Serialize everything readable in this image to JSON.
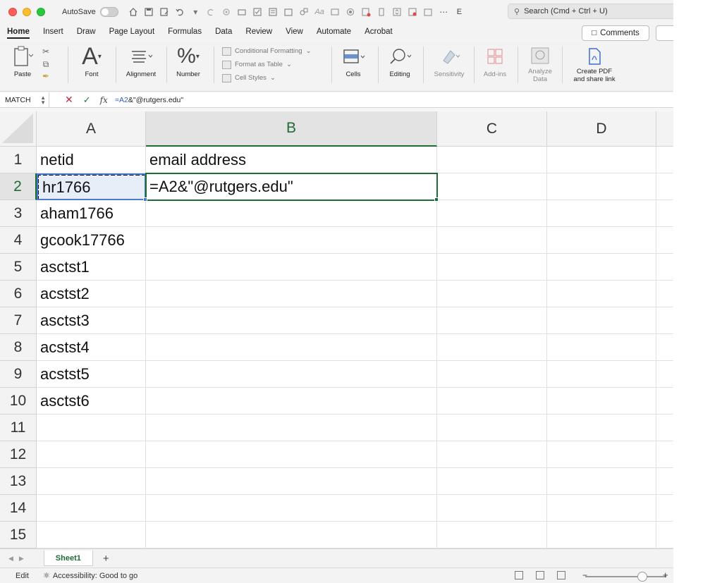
{
  "titlebar": {
    "autosave_label": "AutoSave",
    "title_fragment": "E",
    "search_placeholder": "Search (Cmd + Ctrl + U)"
  },
  "tabs": [
    "Home",
    "Insert",
    "Draw",
    "Page Layout",
    "Formulas",
    "Data",
    "Review",
    "View",
    "Automate",
    "Acrobat"
  ],
  "active_tab": "Home",
  "comments_label": "Comments",
  "ribbon": {
    "paste": "Paste",
    "font": "Font",
    "alignment": "Alignment",
    "number": "Number",
    "conditional_formatting": "Conditional Formatting",
    "format_as_table": "Format as Table",
    "cell_styles": "Cell Styles",
    "cells": "Cells",
    "editing": "Editing",
    "sensitivity": "Sensitivity",
    "add_ins": "Add-ins",
    "analyze_data": "Analyze\nData",
    "create_pdf": "Create PDF\nand share link"
  },
  "formula_bar": {
    "name_box": "MATCH",
    "fx": "fx",
    "formula_ref": "=A2",
    "formula_rest": "&\"@rutgers.edu\""
  },
  "columns": [
    "A",
    "B",
    "C",
    "D"
  ],
  "rows": [
    "1",
    "2",
    "3",
    "4",
    "5",
    "6",
    "7",
    "8",
    "9",
    "10",
    "11",
    "12",
    "13",
    "14",
    "15"
  ],
  "cells": {
    "A1": "netid",
    "B1": "email address",
    "A2": "hr1766",
    "B2": "=A2&\"@rutgers.edu\"",
    "A3": "aham1766",
    "A4": "gcook17766",
    "A5": "asctst1",
    "A6": "acstst2",
    "A7": "asctst3",
    "A8": "acstst4",
    "A9": "acstst5",
    "A10": "asctst6"
  },
  "sheet_tab": "Sheet1",
  "add_sheet": "+",
  "status": {
    "mode": "Edit",
    "accessibility": "Accessibility: Good to go"
  }
}
